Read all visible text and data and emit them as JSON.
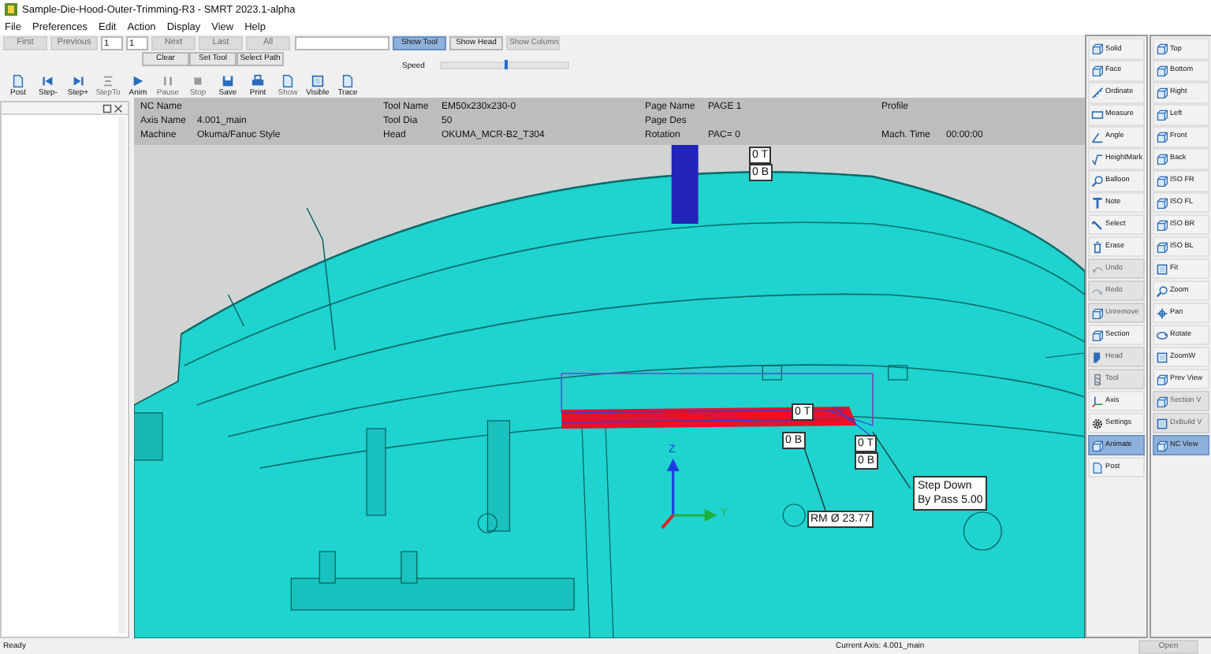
{
  "window": {
    "title": "Sample-Die-Hood-Outer-Trimming-R3 - SMRT 2023.1-alpha"
  },
  "menu": [
    "File",
    "Preferences",
    "Edit",
    "Action",
    "Display",
    "View",
    "Help"
  ],
  "nav_buttons": [
    {
      "label": "First",
      "disabled": true
    },
    {
      "label": "Previous",
      "disabled": true
    }
  ],
  "page_fields": [
    "1",
    "1"
  ],
  "nav_buttons_2": [
    {
      "label": "Next",
      "disabled": true
    },
    {
      "label": "Last",
      "disabled": true
    },
    {
      "label": "All",
      "disabled": true
    }
  ],
  "display_toggles": [
    {
      "label": "Show Tool",
      "selected": true,
      "disabled": false
    },
    {
      "label": "Show Head",
      "selected": false,
      "disabled": false
    },
    {
      "label": "Show Column",
      "selected": false,
      "disabled": true
    }
  ],
  "path_buttons": [
    "Clear",
    "Set Tool",
    "Select Path"
  ],
  "speed": {
    "label": "Speed",
    "level": 0.5
  },
  "actions": [
    {
      "label": "Post",
      "disabled": false
    },
    {
      "label": "Step-",
      "disabled": false
    },
    {
      "label": "Step+",
      "disabled": false
    },
    {
      "label": "StepTo",
      "disabled": true
    },
    {
      "label": "Anim",
      "disabled": false
    },
    {
      "label": "Pause",
      "disabled": true
    },
    {
      "label": "Stop",
      "disabled": true
    },
    {
      "label": "Save",
      "disabled": false
    },
    {
      "label": "Print",
      "disabled": false
    },
    {
      "label": "Show",
      "disabled": true
    },
    {
      "label": "Visible",
      "disabled": false
    },
    {
      "label": "Trace",
      "disabled": false
    }
  ],
  "info": {
    "rows": [
      [
        {
          "label": "NC Name"
        },
        {
          "label": "Tool Name",
          "value": "EM50x230x230-0"
        },
        {
          "label": "Page Name",
          "value": "PAGE 1"
        },
        {
          "label": "Profile"
        }
      ],
      [
        {
          "label": "Axis Name",
          "value": "4.001_main"
        },
        {
          "label": "Tool Dia",
          "value": "50"
        },
        {
          "label": "Page Des"
        }
      ],
      [
        {
          "label": "Machine",
          "value": "Okuma/Fanuc Style"
        },
        {
          "label": "Head",
          "value": "OKUMA_MCR-B2_T304"
        },
        {
          "label": "Rotation",
          "value": "PAC= 0"
        },
        {
          "label": "Mach. Time",
          "value": "00:00:00"
        }
      ]
    ]
  },
  "viewport": {
    "tags": [
      "0 T",
      "0 B",
      "0 T",
      "0 B",
      "0 T",
      "0 B"
    ],
    "diameter": "RM Ø 23.77",
    "step_down": [
      "Step Down",
      "By Pass 5.00"
    ],
    "axes": [
      "Z",
      "Y"
    ]
  },
  "tool_panel": {
    "columns": [
      [
        {
          "label": "Solid",
          "selected": false,
          "disabled": false
        },
        {
          "label": "Face",
          "selected": false,
          "disabled": false
        },
        {
          "label": "Ordinate",
          "selected": false,
          "disabled": false
        },
        {
          "label": "Measure",
          "selected": false,
          "disabled": false
        },
        {
          "label": "Angle",
          "selected": false,
          "disabled": false
        },
        {
          "label": "HeightMark",
          "selected": false,
          "disabled": false
        },
        {
          "label": "Balloon",
          "selected": false,
          "disabled": false
        },
        {
          "label": "Note",
          "selected": false,
          "disabled": false
        },
        {
          "label": "Select",
          "selected": false,
          "disabled": false
        },
        {
          "label": "Erase",
          "selected": false,
          "disabled": false
        },
        {
          "label": "Undo",
          "selected": false,
          "disabled": true
        },
        {
          "label": "Redo",
          "selected": false,
          "disabled": true
        },
        {
          "label": "Unremove",
          "selected": false,
          "disabled": true
        },
        {
          "label": "Section",
          "selected": false,
          "disabled": false
        },
        {
          "label": "Head",
          "selected": false,
          "disabled": true
        },
        {
          "label": "Tool",
          "selected": false,
          "disabled": true
        },
        {
          "label": "Axis",
          "selected": false,
          "disabled": false
        },
        {
          "label": "Settings",
          "selected": false,
          "disabled": false
        },
        {
          "label": "Animate",
          "selected": true,
          "disabled": false
        },
        {
          "label": "Post",
          "selected": false,
          "disabled": false
        }
      ],
      [
        {
          "label": "Top",
          "selected": false,
          "disabled": false
        },
        {
          "label": "Bottom",
          "selected": false,
          "disabled": false
        },
        {
          "label": "Right",
          "selected": false,
          "disabled": false
        },
        {
          "label": "Left",
          "selected": false,
          "disabled": false
        },
        {
          "label": "Front",
          "selected": false,
          "disabled": false
        },
        {
          "label": "Back",
          "selected": false,
          "disabled": false
        },
        {
          "label": "ISO FR",
          "selected": false,
          "disabled": false
        },
        {
          "label": "ISO FL",
          "selected": false,
          "disabled": false
        },
        {
          "label": "ISO BR",
          "selected": false,
          "disabled": false
        },
        {
          "label": "ISO BL",
          "selected": false,
          "disabled": false
        },
        {
          "label": "Fit",
          "selected": false,
          "disabled": false
        },
        {
          "label": "Zoom",
          "selected": false,
          "disabled": false
        },
        {
          "label": "Pan",
          "selected": false,
          "disabled": false
        },
        {
          "label": "Rotate",
          "selected": false,
          "disabled": false
        },
        {
          "label": "ZoomW",
          "selected": false,
          "disabled": false
        },
        {
          "label": "Prev View",
          "selected": false,
          "disabled": false
        },
        {
          "label": "Section V",
          "selected": false,
          "disabled": true
        },
        {
          "label": "DxBuild V",
          "selected": false,
          "disabled": true
        },
        {
          "label": "NC View",
          "selected": true,
          "disabled": false
        }
      ]
    ]
  },
  "open_button": {
    "label": "Open",
    "disabled": true
  },
  "status_bar": {
    "message": "Ready",
    "axis": "Current Axis: 4.001_main"
  }
}
